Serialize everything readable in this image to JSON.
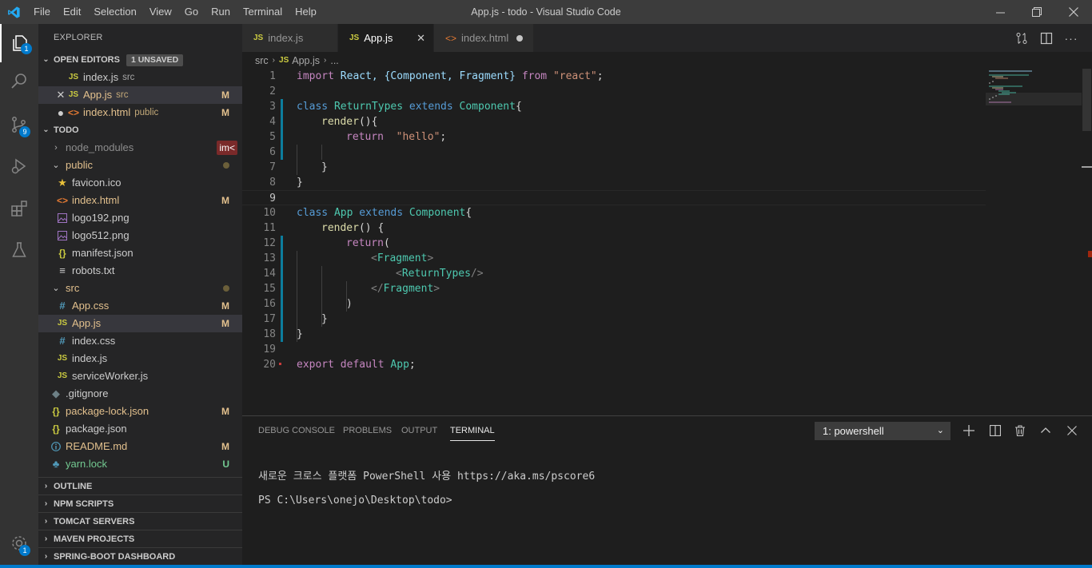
{
  "titlebar": {
    "title": "App.js - todo - Visual Studio Code",
    "menus": [
      "File",
      "Edit",
      "Selection",
      "View",
      "Go",
      "Run",
      "Terminal",
      "Help"
    ]
  },
  "activitybar": {
    "explorer_badge": "1",
    "scm_badge": "9",
    "settings_badge": "1"
  },
  "sidebar": {
    "title": "EXPLORER",
    "open_editors": {
      "label": "OPEN EDITORS",
      "unsaved": "1 UNSAVED",
      "items": [
        {
          "name": "index.js",
          "desc": "src",
          "tag": ""
        },
        {
          "name": "App.js",
          "desc": "src",
          "tag": "M"
        },
        {
          "name": "index.html",
          "desc": "public",
          "tag": "M"
        }
      ]
    },
    "workspace": {
      "label": "TODO",
      "node_modules": "node_modules",
      "node_modules_badge": "im<",
      "public": "public",
      "public_files": [
        {
          "name": "favicon.ico",
          "tag": ""
        },
        {
          "name": "index.html",
          "tag": "M"
        },
        {
          "name": "logo192.png",
          "tag": ""
        },
        {
          "name": "logo512.png",
          "tag": ""
        },
        {
          "name": "manifest.json",
          "tag": ""
        },
        {
          "name": "robots.txt",
          "tag": ""
        }
      ],
      "src": "src",
      "src_files": [
        {
          "name": "App.css",
          "tag": "M"
        },
        {
          "name": "App.js",
          "tag": "M"
        },
        {
          "name": "index.css",
          "tag": ""
        },
        {
          "name": "index.js",
          "tag": ""
        },
        {
          "name": "serviceWorker.js",
          "tag": ""
        }
      ],
      "root_files": [
        {
          "name": ".gitignore",
          "tag": ""
        },
        {
          "name": "package-lock.json",
          "tag": "M"
        },
        {
          "name": "package.json",
          "tag": ""
        },
        {
          "name": "README.md",
          "tag": "M"
        },
        {
          "name": "yarn.lock",
          "tag": "U"
        }
      ]
    },
    "bottom_sections": [
      "OUTLINE",
      "NPM SCRIPTS",
      "TOMCAT SERVERS",
      "MAVEN PROJECTS",
      "SPRING-BOOT DASHBOARD"
    ]
  },
  "editor": {
    "tabs": [
      {
        "label": "index.js"
      },
      {
        "label": "App.js"
      },
      {
        "label": "index.html"
      }
    ],
    "breadcrumb": {
      "folder": "src",
      "file": "App.js",
      "more": "..."
    },
    "line_numbers": [
      "1",
      "2",
      "3",
      "4",
      "5",
      "6",
      "7",
      "8",
      "9",
      "10",
      "11",
      "12",
      "13",
      "14",
      "15",
      "16",
      "17",
      "18",
      "19",
      "20"
    ],
    "code": {
      "l1": {
        "k1": "import",
        "a": " React, {",
        "c1": "Component",
        "b": ", ",
        "c2": "Fragment",
        "c": "} ",
        "k2": "from",
        "d": " ",
        "s": "\"react\"",
        "e": ";"
      },
      "l3": {
        "k1": "class",
        "n": " ReturnTypes ",
        "k2": "extends",
        "c": " Component",
        "e": "{"
      },
      "l4": {
        "f": "render",
        "e": "(){"
      },
      "l5": {
        "k": "return",
        "s": "\"hello\"",
        "e": ";"
      },
      "l7": {
        "e": "}"
      },
      "l8": {
        "e": "}"
      },
      "l10": {
        "k1": "class",
        "n": " App ",
        "k2": "extends",
        "c": " Component",
        "e": "{"
      },
      "l11": {
        "f": "render",
        "e": "() {"
      },
      "l12": {
        "k": "return",
        "e": "("
      },
      "l13": {
        "o": "<",
        "t": "Fragment",
        "c": ">"
      },
      "l14": {
        "o": "<",
        "t": "ReturnTypes",
        "c": "/>"
      },
      "l15": {
        "o": "</",
        "t": "Fragment",
        "c": ">"
      },
      "l16": {
        "e": ")"
      },
      "l17": {
        "e": "}"
      },
      "l18": {
        "e": "}"
      },
      "l20": {
        "k1": "export",
        "sp": " ",
        "k2": "default",
        "n": " App",
        "e": ";"
      }
    }
  },
  "panel": {
    "tabs": [
      "DEBUG CONSOLE",
      "PROBLEMS",
      "OUTPUT",
      "TERMINAL"
    ],
    "terminal_select": "1: powershell",
    "terminal_lines": [
      "새로운 크로스 플랫폼 PowerShell 사용 https://aka.ms/pscore6",
      "PS C:\\Users\\onejo\\Desktop\\todo>"
    ]
  },
  "colors": {
    "accent": "#007acc",
    "modified": "#e2c08d",
    "untracked": "#73c991"
  }
}
